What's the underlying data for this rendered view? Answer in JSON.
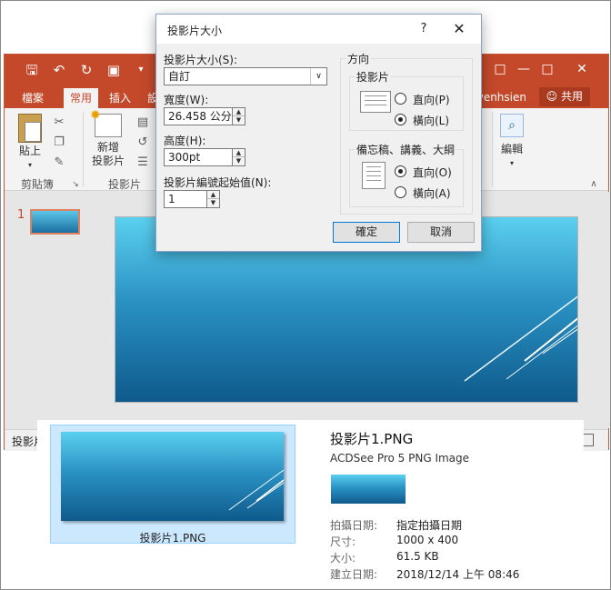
{
  "ppt": {
    "qat": [
      "save-icon",
      "undo-icon",
      "redo-icon",
      "slideshow-icon",
      "more-icon"
    ],
    "tabs": [
      "檔案",
      "常用",
      "插入",
      "設"
    ],
    "user_fragment": "venhsien",
    "share_label": "共用",
    "ribbon": {
      "paste_label": "貼上",
      "new_slide_label": "新增\n投影片",
      "clipboard_group": "剪貼簿",
      "slides_group": "投影片",
      "edit_label": "編輯"
    },
    "slide_number": "1",
    "status_left": "投影片"
  },
  "dialog": {
    "title": "投影片大小",
    "help": "?",
    "close": "✕",
    "size_label": "投影片大小(S):",
    "size_value": "自訂",
    "width_label": "寬度(W):",
    "width_value": "26.458 公分",
    "height_label": "高度(H):",
    "height_value": "300pt",
    "start_label": "投影片編號起始值(N):",
    "start_value": "1",
    "orientation_title": "方向",
    "slides_group": "投影片",
    "portrait_label": "直向(P)",
    "landscape_label": "橫向(L)",
    "notes_group": "備忘稿、講義、大綱",
    "notes_portrait_label": "直向(O)",
    "notes_landscape_label": "橫向(A)",
    "ok": "確定",
    "cancel": "取消"
  },
  "preview": {
    "tile_caption": "投影片1.PNG",
    "file_name": "投影片1.PNG",
    "file_type": "ACDSee Pro 5 PNG Image",
    "props": [
      {
        "label": "拍攝日期:",
        "value": "指定拍攝日期"
      },
      {
        "label": "尺寸:",
        "value": "1000 x 400"
      },
      {
        "label": "大小:",
        "value": "61.5 KB"
      },
      {
        "label": "建立日期:",
        "value": "2018/12/14 上午 08:46"
      }
    ]
  }
}
